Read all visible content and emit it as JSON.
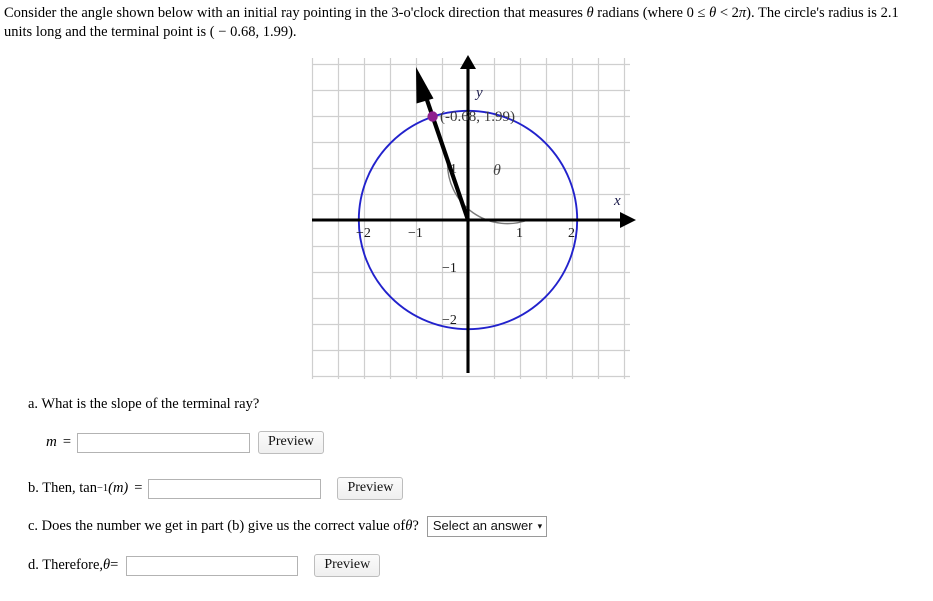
{
  "prompt": {
    "line1_a": "Consider the angle shown below with an initial ray pointing in the 3-o'clock direction that measures ",
    "theta_sym": "θ",
    "line1_b": " radians (where 0 ",
    "le_sym": "≤",
    "line1_c": " ",
    "line1_d": " < 2",
    "pi_sym": "π",
    "line1_e": "). The circle's",
    "line2_a": "radius is 2.1 units long and the terminal point is ( ",
    "minus_sym": "−",
    "line2_b": " 0.68, 1.99)."
  },
  "graph": {
    "x_axis_label": "x",
    "y_axis_label": "y",
    "angle_label": "θ",
    "point_label": "(-0.68, 1.99)",
    "x_ticks": [
      "−2",
      "−1",
      "1",
      "2"
    ],
    "y_ticks": [
      "1",
      "−1",
      "−2"
    ],
    "circle_color": "#2222cc",
    "point_color": "#8e1f8e",
    "grid_color": "#cfcfcf",
    "axis_color": "#000000",
    "arc_color": "#777777",
    "circle_radius_units": 2.1,
    "terminal_point": [
      -0.68,
      1.99
    ]
  },
  "questions": {
    "a": {
      "text": "a. What is the slope of the terminal ray?",
      "var_label": "m",
      "equals": "=",
      "input_value": "",
      "input_placeholder": "",
      "preview_label": "Preview"
    },
    "b": {
      "prefix": "b. Then, tan",
      "exponent": "−1",
      "arg": "(m)",
      "equals": "=",
      "input_value": "",
      "input_placeholder": "",
      "preview_label": "Preview"
    },
    "c": {
      "text_a": "c. Does the number we get in part (b) give us the correct value of ",
      "theta_sym": "θ",
      "text_b": "?",
      "select_label": "Select an answer",
      "caret": "▾"
    },
    "d": {
      "prefix": "d. Therefore, ",
      "theta_sym": "θ",
      "equals": " =",
      "input_value": "",
      "input_placeholder": "",
      "preview_label": "Preview"
    }
  }
}
